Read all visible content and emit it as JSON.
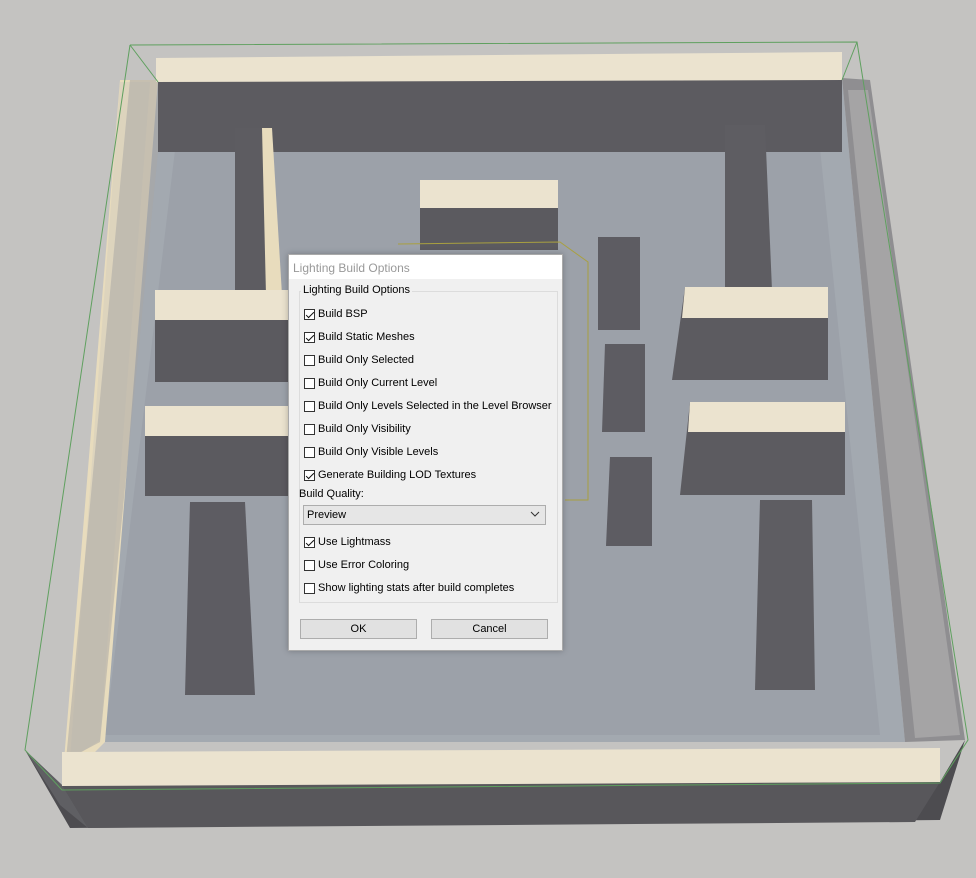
{
  "dialog": {
    "title": "Lighting Build Options",
    "group_label": "Lighting Build Options",
    "checkboxes": [
      {
        "label": "Build BSP",
        "checked": true
      },
      {
        "label": "Build Static Meshes",
        "checked": true
      },
      {
        "label": "Build Only Selected",
        "checked": false
      },
      {
        "label": "Build Only Current Level",
        "checked": false
      },
      {
        "label": "Build Only Levels Selected in the Level Browser",
        "checked": false
      },
      {
        "label": "Build Only Visibility",
        "checked": false
      },
      {
        "label": "Build Only Visible Levels",
        "checked": false
      },
      {
        "label": "Generate Building LOD Textures",
        "checked": true
      }
    ],
    "quality_label": "Build Quality:",
    "quality_value": "Preview",
    "options": [
      {
        "label": "Use Lightmass",
        "checked": true
      },
      {
        "label": "Use Error Coloring",
        "checked": false
      },
      {
        "label": "Show lighting stats after build completes",
        "checked": false
      }
    ],
    "ok_label": "OK",
    "cancel_label": "Cancel"
  },
  "scene": {
    "background_color": "#c4c3c1",
    "floor_color": "#a3a9b0",
    "wall_top_color": "#e9e1cc",
    "shadow_color": "#7a7a7d",
    "bounds_color": "#5fa05f"
  }
}
